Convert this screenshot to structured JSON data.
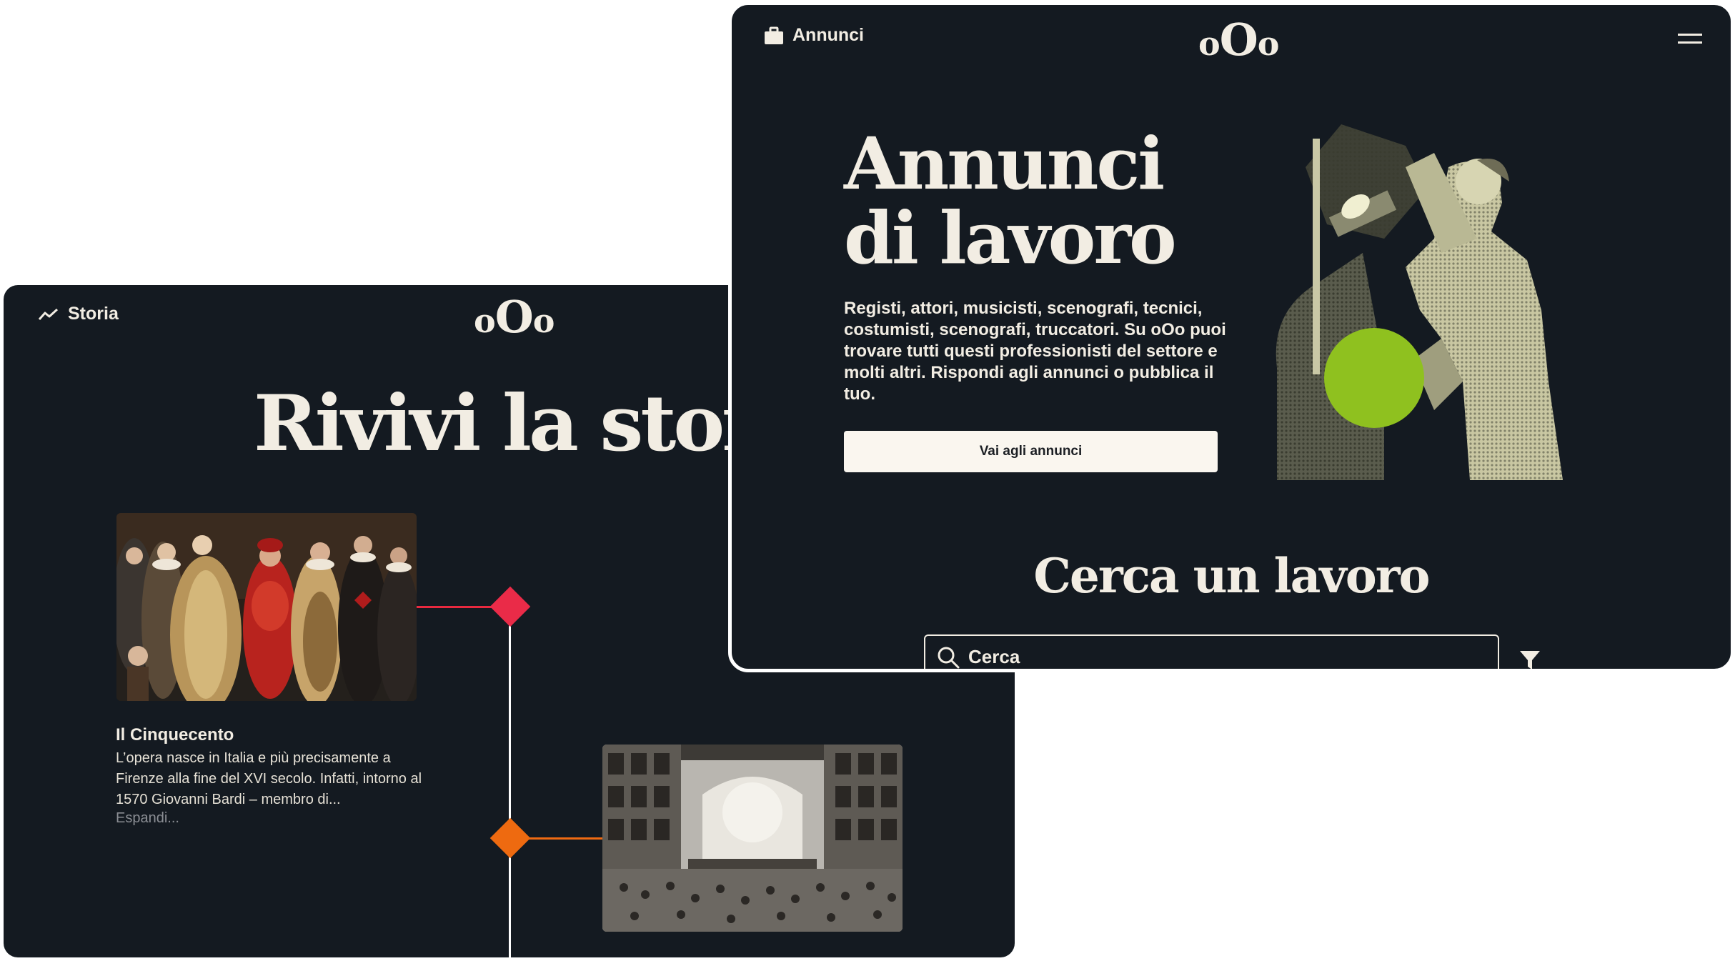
{
  "storia_screen": {
    "nav_label": "Storia",
    "logo": {
      "left": "o",
      "middle": "O",
      "right": "o"
    },
    "hero_title": "Rivivi la storia",
    "timeline": [
      {
        "title": "Il Cinquecento",
        "text": "L’opera nasce in Italia e più precisamente a Firenze alla fine del XVI secolo. Infatti, intorno al 1570 Giovanni Bardi – membro di...",
        "more": "Espandi...",
        "marker_color": "#ea2b48"
      },
      {
        "marker_color": "#ee6a10"
      }
    ]
  },
  "annunci_screen": {
    "nav_label": "Annunci",
    "logo": {
      "left": "o",
      "middle": "O",
      "right": "o"
    },
    "hero_title_line1": "Annunci",
    "hero_title_line2": "di lavoro",
    "description": "Registi, attori, musicisti, scenografi, tecnici, costumisti, scenografi, truccatori. Su oOo puoi trovare tutti questi professionisti del settore e molti altri. Rispondi agli annunci o pubblica il tuo.",
    "cta_label": "Vai agli annunci",
    "section_title": "Cerca un lavoro",
    "search": {
      "placeholder": "Cerca",
      "value": ""
    },
    "accent_color": "#8fc11f"
  },
  "colors": {
    "background_dark": "#141a21",
    "text_light": "#f2ede3"
  }
}
